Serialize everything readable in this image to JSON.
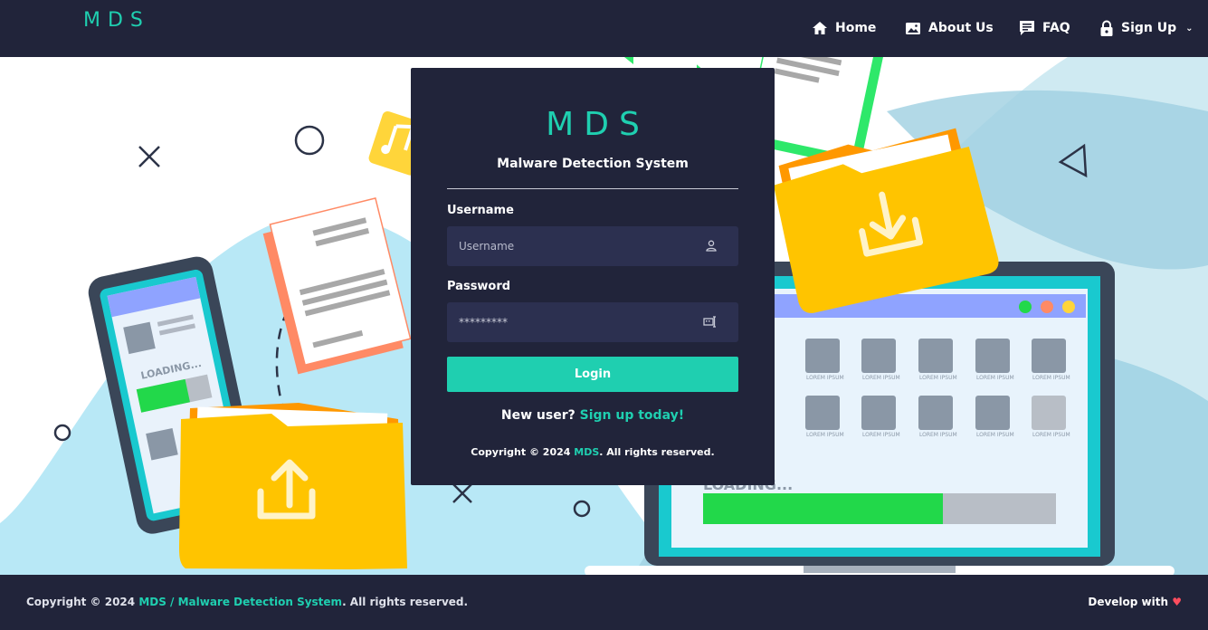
{
  "navbar": {
    "brand": "MDS",
    "items": [
      {
        "label": "Home",
        "icon": "home-icon"
      },
      {
        "label": "About Us",
        "icon": "image-icon"
      },
      {
        "label": "FAQ",
        "icon": "chat-icon"
      },
      {
        "label": "Sign Up",
        "icon": "lock-icon"
      }
    ]
  },
  "login": {
    "logo": "MDS",
    "subtitle": "Malware Detection System",
    "username_label": "Username",
    "username_placeholder": "Username",
    "password_label": "Password",
    "password_value": "*********",
    "button_label": "Login",
    "new_user_text": "New user?",
    "signup_link": "Sign up today!",
    "copyright_prefix": "Copyright © 2024",
    "copyright_brand": "MDS",
    "copyright_suffix": ". All rights reserved."
  },
  "art": {
    "loading_text": "LOADING...",
    "item_caption": "LOREM IPSUM"
  },
  "footer": {
    "copyright_prefix": "Copyright © 2024",
    "copyright_link": "MDS / Malware Detection System",
    "copyright_suffix": ". All rights reserved.",
    "develop_text": "Develop with",
    "heart": "♥"
  },
  "colors": {
    "accent": "#1fcfb0",
    "navy": "#21243a",
    "field": "#2c3050",
    "folder": "#ffc400",
    "folder_tab": "#ff9800"
  }
}
